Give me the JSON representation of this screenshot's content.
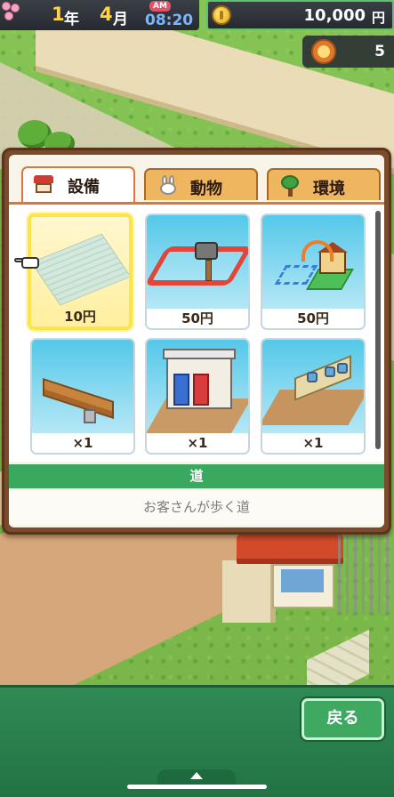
{
  "hud": {
    "year": "1",
    "year_unit": "年",
    "month": "4",
    "month_unit": "月",
    "ampm": "AM",
    "time": "08:20",
    "money": "10,000",
    "money_unit": "円",
    "rank": "5"
  },
  "tabs": [
    {
      "label": "設備",
      "icon": "shop-icon",
      "active": true
    },
    {
      "label": "動物",
      "icon": "rabbit-icon",
      "active": false
    },
    {
      "label": "環境",
      "icon": "tree-icon",
      "active": false
    }
  ],
  "items": [
    {
      "name": "road",
      "price": "10円",
      "selected": true
    },
    {
      "name": "construct",
      "price": "50円",
      "selected": false
    },
    {
      "name": "move",
      "price": "50円",
      "selected": false
    },
    {
      "name": "bench",
      "price": "×1",
      "selected": false
    },
    {
      "name": "toilet",
      "price": "×1",
      "selected": false
    },
    {
      "name": "washbasin",
      "price": "×1",
      "selected": false
    }
  ],
  "detail": {
    "name": "道",
    "description": "お客さんが歩く道"
  },
  "footer": {
    "back_label": "戻る"
  },
  "colors": {
    "accent_orange": "#e07535",
    "panel_brown": "#7a4a2a",
    "bar_green": "#3aa85f",
    "selected_yellow": "#ffe34a"
  }
}
